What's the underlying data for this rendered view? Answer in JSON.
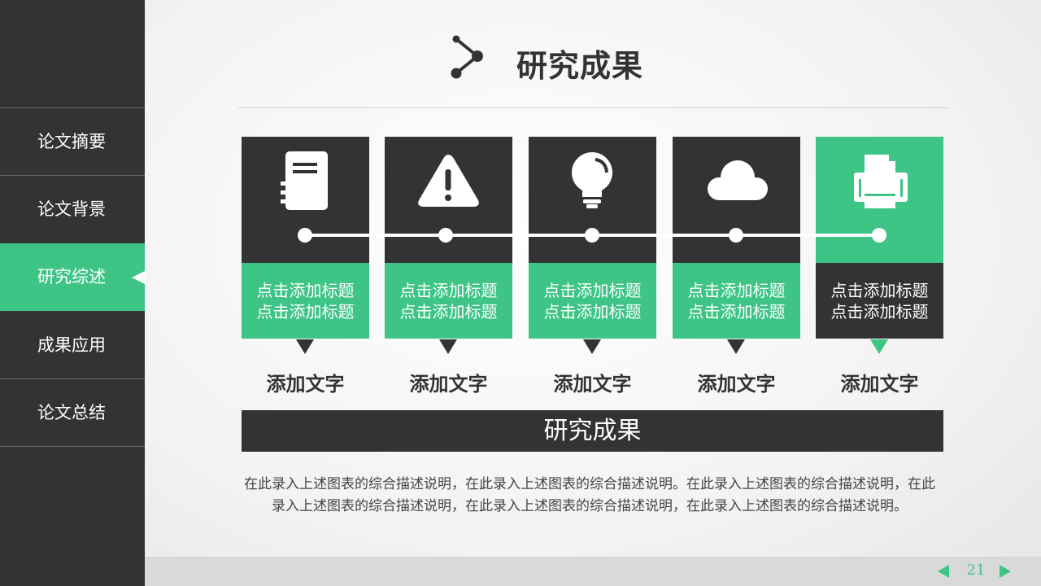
{
  "sidebar": {
    "items": [
      {
        "label": "论文摘要"
      },
      {
        "label": "论文背景"
      },
      {
        "label": "研究综述"
      },
      {
        "label": "成果应用"
      },
      {
        "label": "论文总结"
      }
    ],
    "active_index": 2
  },
  "header": {
    "title": "研究成果",
    "icon": "share-node-icon"
  },
  "cards": [
    {
      "icon": "document-icon",
      "line1": "点击添加标题",
      "line2": "点击添加标题",
      "label": "添加文字",
      "highlight": false
    },
    {
      "icon": "warning-icon",
      "line1": "点击添加标题",
      "line2": "点击添加标题",
      "label": "添加文字",
      "highlight": false
    },
    {
      "icon": "lightbulb-icon",
      "line1": "点击添加标题",
      "line2": "点击添加标题",
      "label": "添加文字",
      "highlight": false
    },
    {
      "icon": "cloud-icon",
      "line1": "点击添加标题",
      "line2": "点击添加标题",
      "label": "添加文字",
      "highlight": false
    },
    {
      "icon": "printer-icon",
      "line1": "点击添加标题",
      "line2": "点击添加标题",
      "label": "添加文字",
      "highlight": true
    }
  ],
  "banner": {
    "text": "研究成果"
  },
  "description": "在此录入上述图表的综合描述说明，在此录入上述图表的综合描述说明。在此录入上述图表的综合描述说明，在此录入上述图表的综合描述说明，在此录入上述图表的综合描述说明，在此录入上述图表的综合描述说明。",
  "footer": {
    "page_number": "21"
  },
  "colors": {
    "accent": "#3ec586",
    "dark": "#333333"
  }
}
